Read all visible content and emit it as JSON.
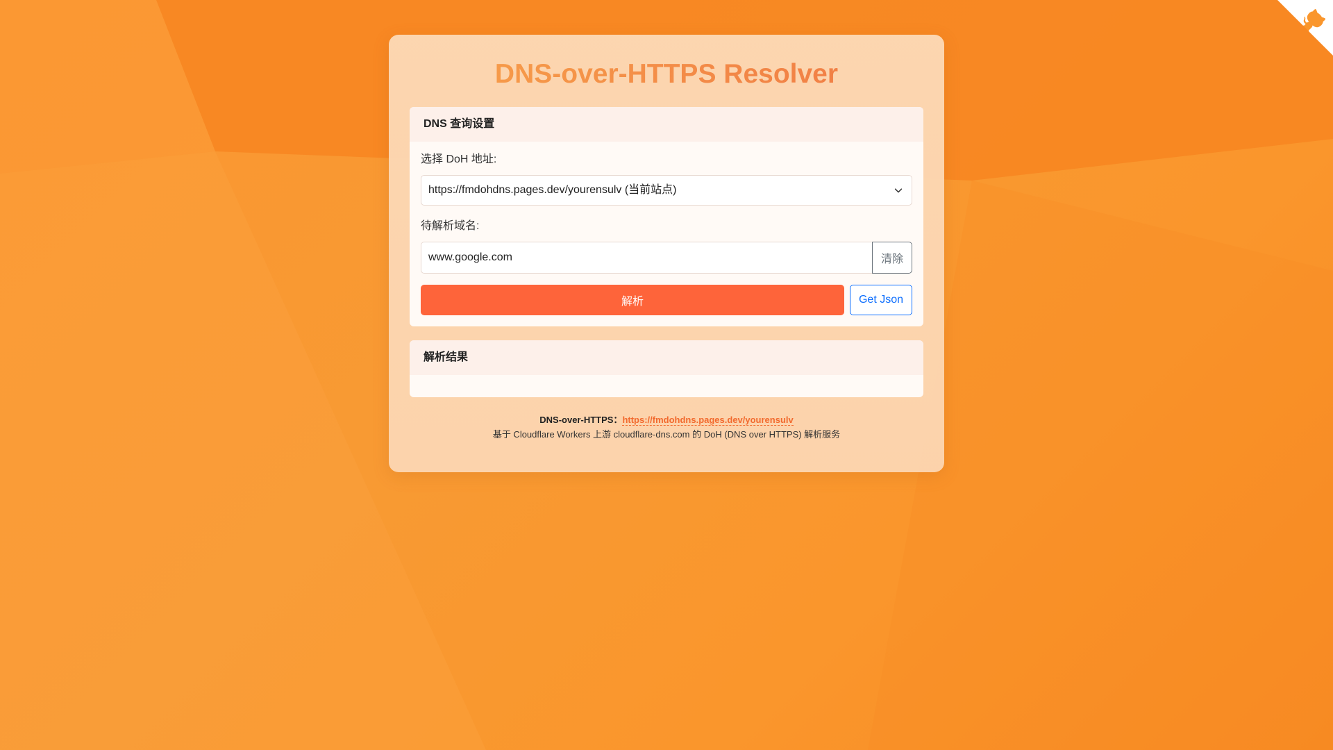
{
  "app": {
    "title": "DNS-over-HTTPS Resolver"
  },
  "settings_panel": {
    "header": "DNS 查询设置",
    "doh_label": "选择 DoH 地址:",
    "doh_selected": "https://fmdohdns.pages.dev/yourensulv (当前站点)",
    "domain_label": "待解析域名:",
    "domain_value": "www.google.com",
    "clear_label": "清除",
    "resolve_label": "解析",
    "json_label": "Get Json"
  },
  "result_panel": {
    "header": "解析结果"
  },
  "footer": {
    "doh_label": "DNS-over-HTTPS：",
    "doh_link": "https://fmdohdns.pages.dev/yourensulv",
    "description": "基于 Cloudflare Workers 上游 cloudflare-dns.com 的 DoH (DNS over HTTPS) 解析服务"
  },
  "icons": {
    "corner": "github-octocat-icon",
    "select_arrow": "chevron-down-icon"
  },
  "colors": {
    "background": "#fa962c",
    "title_start": "#f7a04a",
    "title_end": "#f07a45",
    "primary_button": "#fe643a",
    "json_button": "#0d6efd",
    "link": "#f26a2e"
  }
}
